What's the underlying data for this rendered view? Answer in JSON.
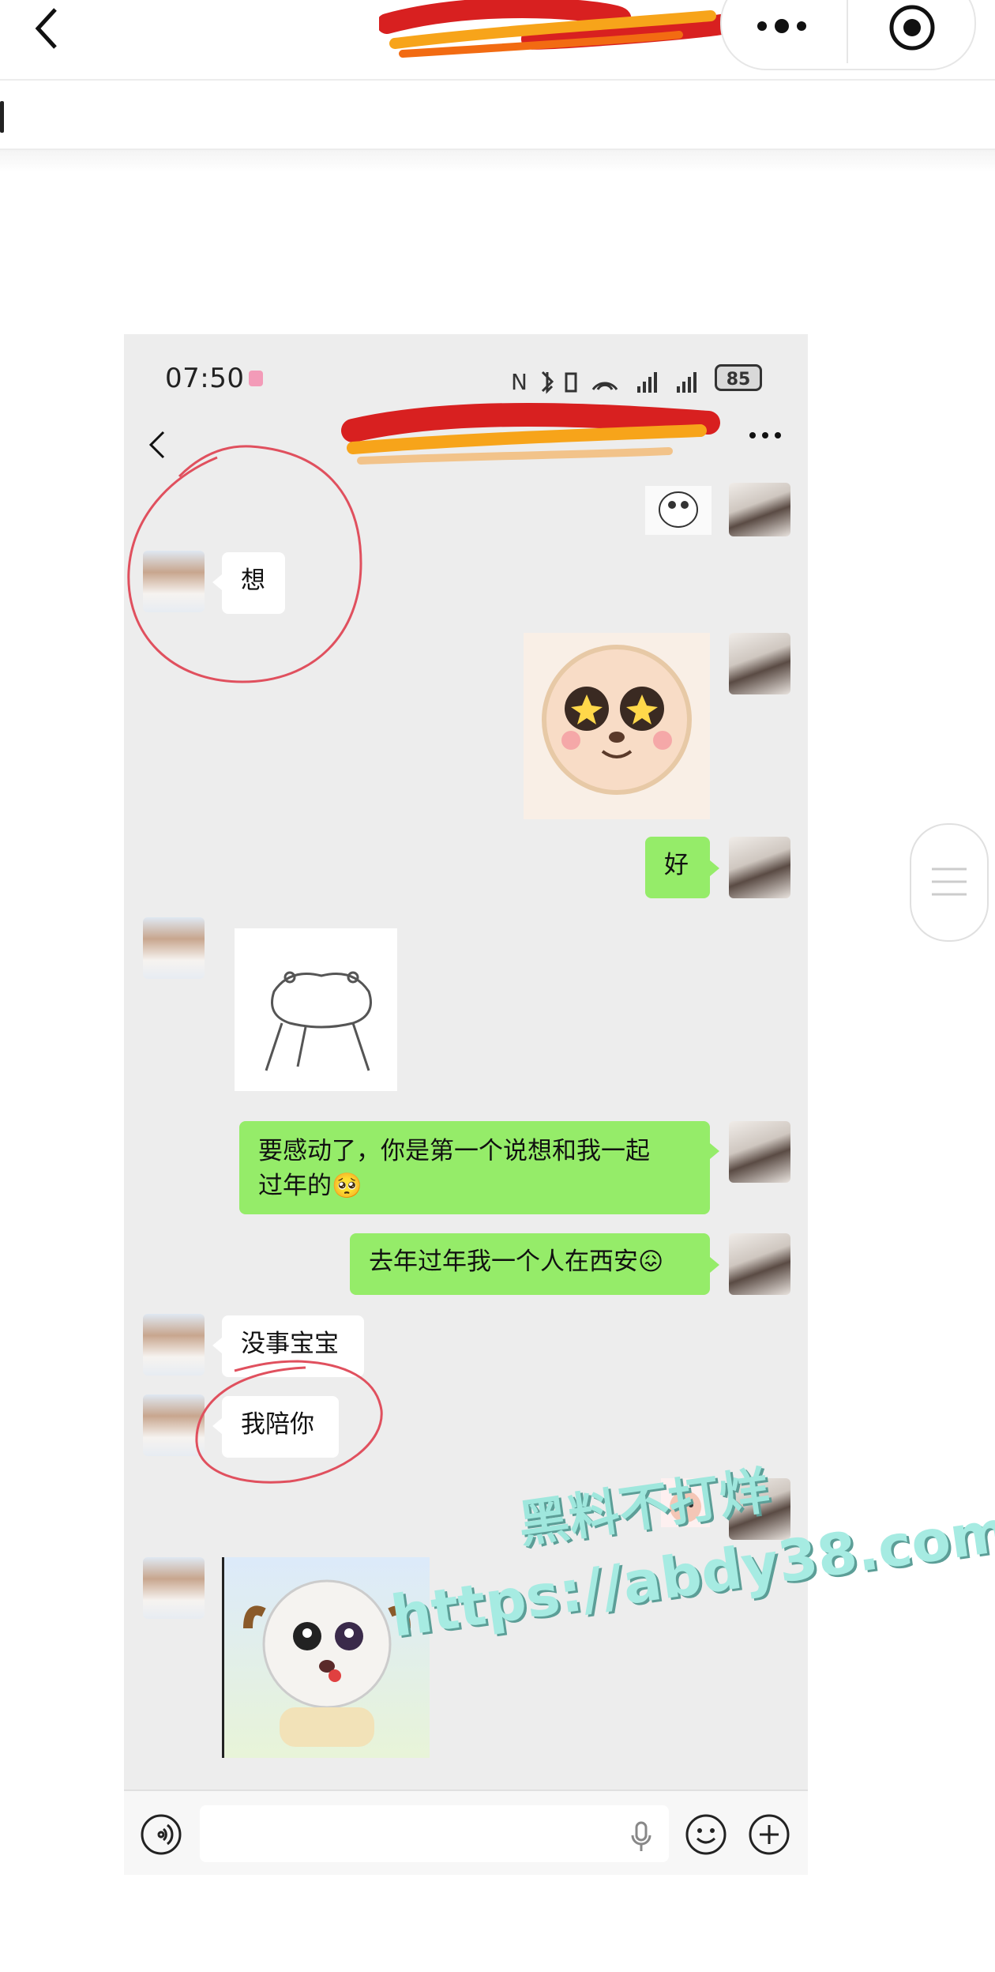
{
  "phone": {
    "status_time": "07:50",
    "battery": "85"
  },
  "messages": {
    "m1": "想",
    "m2": "好",
    "m3_line1": "要感动了，你是第一个说想和我一起",
    "m3_line2": "过年的🥺",
    "m4": "去年过年我一个人在西安😖",
    "m5": "没事宝宝",
    "m6": "我陪你"
  },
  "watermark": {
    "text": "黑料不打烊",
    "url": "https://abdy38.com"
  },
  "icons": {
    "outer_back": "chevron-left-icon",
    "outer_more": "more-dots-icon",
    "outer_record": "record-icon",
    "phone_back": "chevron-left-icon",
    "phone_more": "more-dots-icon",
    "voice": "voice-icon",
    "mic": "mic-icon",
    "emoji": "emoji-icon",
    "plus": "plus-icon"
  },
  "colors": {
    "sent_bubble": "#95ec69",
    "received_bubble": "#ffffff",
    "chat_bg": "#ededed",
    "annotation": "#e0505e"
  }
}
